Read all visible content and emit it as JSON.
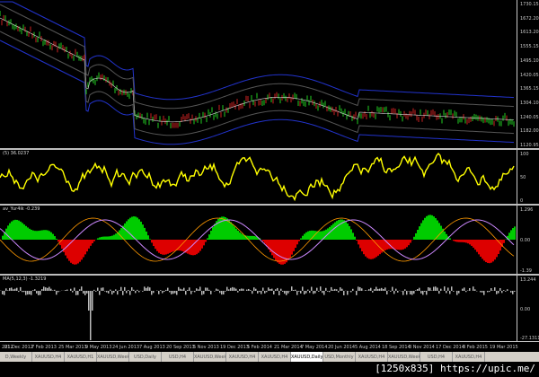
{
  "price_axis": [
    "1730.15",
    "1672.20",
    "1613.20",
    "1555.15",
    "1495.10",
    "1420.05",
    "1365.15",
    "1304.10",
    "1240.05",
    "1182.00",
    "1120.95"
  ],
  "osc1": {
    "label": "(5) 36.0237",
    "axis": [
      "100",
      "50",
      "0"
    ],
    "line_color": "#ffff00"
  },
  "osc2": {
    "label": "av_Yur4ik -0.239",
    "axis": [
      "1.296",
      "0.00",
      "-1.39"
    ],
    "pos_color": "#00cc00",
    "neg_color": "#dd0000"
  },
  "osc3": {
    "label": "MA(5,12,3) -1.3219",
    "axis": [
      "13.244",
      "0.00",
      "-27.1311"
    ]
  },
  "time_axis": [
    "2012",
    "21 Dec 2012",
    "7 Feb 2013",
    "25 Mar 2013",
    "9 May 2013",
    "24 Jun 2013",
    "7 Aug 2013",
    "20 Sep 2013",
    "5 Nov 2013",
    "19 Dec 2013",
    "5 Feb 2014",
    "21 Mar 2014",
    "7 May 2014",
    "20 Jun 2014",
    "5 Aug 2014",
    "18 Sep 2014",
    "3 Nov 2014",
    "17 Dec 2014",
    "3 Feb 2015",
    "19 Mar 2015"
  ],
  "tabs": [
    "D,Weekly",
    "XAUUSD,H4",
    "XAUUSD,H1",
    "XAUUSD,Weekly",
    "USD,Daily",
    "USD,H4",
    "XAUUSD,Weekly",
    "XAUUSD,H4",
    "XAUUSD,H4",
    "XAUUSD,Daily",
    "USD,Monthly",
    "XAUUSD,H4",
    "XAUUSD,Weekly",
    "USD,H4",
    "XAUUSD,H4"
  ],
  "active_tab": 9,
  "watermark": "[1250x835] https://upic.me/"
}
